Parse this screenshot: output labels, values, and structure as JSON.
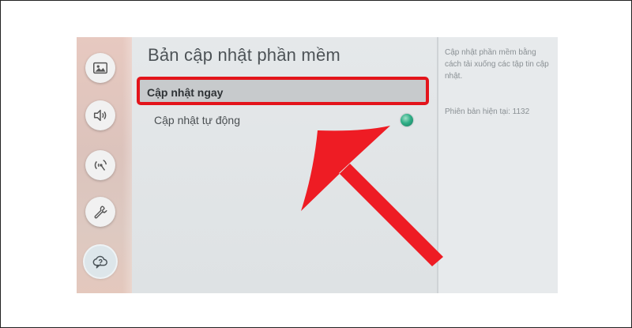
{
  "settings": {
    "title": "Bản cập nhật phần mềm",
    "items": [
      {
        "label": "Cập nhật ngay",
        "highlighted": true
      },
      {
        "label": "Cập nhật tự động",
        "toggle_on": true
      }
    ]
  },
  "info_panel": {
    "description": "Cập nhật phần mềm bằng cách tải xuống các tập tin cập nhật.",
    "version": "Phiên bản hiện tại: 1132"
  },
  "sidebar": {
    "items": [
      {
        "icon": "picture-icon"
      },
      {
        "icon": "sound-icon"
      },
      {
        "icon": "broadcast-icon"
      },
      {
        "icon": "wrench-icon"
      },
      {
        "icon": "support-cloud-icon",
        "active": true
      }
    ]
  },
  "colors": {
    "highlight_border": "#e3141b",
    "arrow": "#ee1c24",
    "toggle": "#2fae86"
  }
}
